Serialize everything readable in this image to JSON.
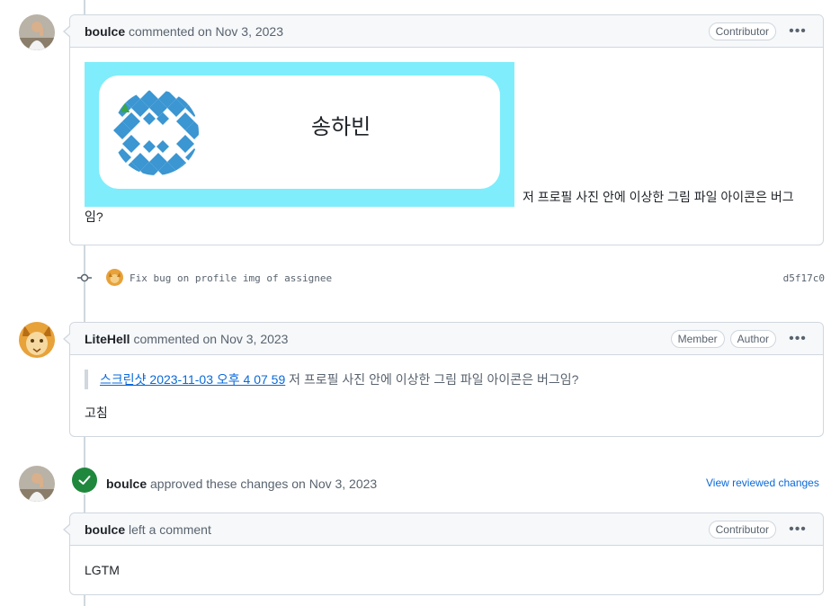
{
  "comment1": {
    "author": "boulce",
    "action": "commented on Nov 3, 2023",
    "badge": "Contributor",
    "menu": "•••",
    "image_name": "송하빈",
    "text": "저 프로필 사진 안에 이상한 그림 파일 아이콘은 버그임?"
  },
  "commit": {
    "message": "Fix bug on profile img of assignee",
    "sha": "d5f17c0"
  },
  "comment2": {
    "author": "LiteHell",
    "action": "commented on Nov 3, 2023",
    "badges": [
      "Member",
      "Author"
    ],
    "menu": "•••",
    "quote_link": "스크린샷 2023-11-03 오후 4 07 59",
    "quote_text": " 저 프로필 사진 안에 이상한 그림 파일 아이콘은 버그임?",
    "body": "고침"
  },
  "review": {
    "author": "boulce",
    "action": "approved these changes on Nov 3, 2023",
    "view_link": "View reviewed changes"
  },
  "review_comment": {
    "author": "boulce",
    "action": "left a comment",
    "badge": "Contributor",
    "menu": "•••",
    "body": "LGTM"
  },
  "colors": {
    "approved_green": "#1f883d",
    "image_bg": "#7fedfb",
    "link_blue": "#0969da"
  }
}
